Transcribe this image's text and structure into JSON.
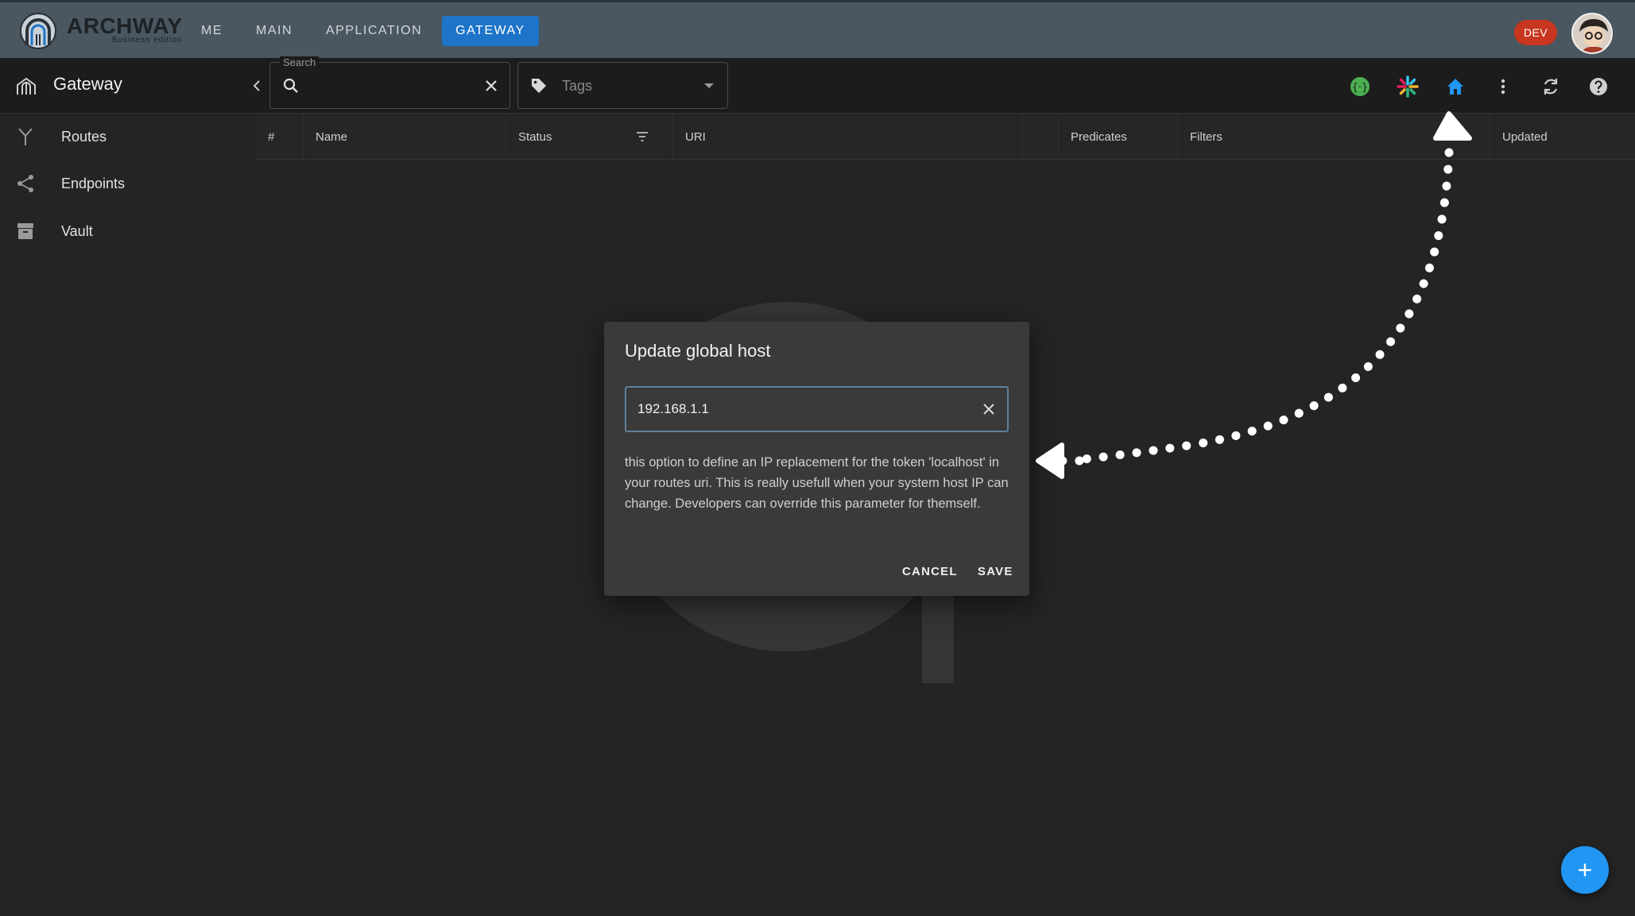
{
  "app": {
    "brand_name": "ARCHWAY",
    "brand_subtitle": "Business edition",
    "env_badge": "DEV"
  },
  "nav": {
    "items": [
      {
        "label": "ME"
      },
      {
        "label": "MAIN"
      },
      {
        "label": "APPLICATION"
      },
      {
        "label": "GATEWAY",
        "active": true
      }
    ]
  },
  "toolbar": {
    "section_title": "Gateway",
    "search": {
      "legend": "Search",
      "value": "",
      "placeholder": ""
    },
    "tags": {
      "label": "Tags"
    },
    "icons": [
      "api-status-icon",
      "slack-icon",
      "home-icon",
      "more-vert-icon",
      "refresh-icon",
      "help-icon"
    ],
    "accent_color": "#1e74c8"
  },
  "sidebar": {
    "items": [
      {
        "label": "Routes",
        "icon": "routes-fork-icon"
      },
      {
        "label": "Endpoints",
        "icon": "share-icon"
      },
      {
        "label": "Vault",
        "icon": "archive-icon"
      }
    ]
  },
  "table": {
    "columns": [
      "#",
      "Name",
      "Status",
      "URI",
      "Predicates",
      "Filters",
      "Updated"
    ]
  },
  "dialog": {
    "title": "Update global host",
    "input_value": "192.168.1.1",
    "help_text": "this option to define an IP replacement for the token 'localhost' in your routes uri. This is really usefull when your system host IP can change. Developers can override this parameter for themself.",
    "cancel_label": "CANCEL",
    "save_label": "SAVE"
  },
  "fab": {
    "label": "+"
  }
}
